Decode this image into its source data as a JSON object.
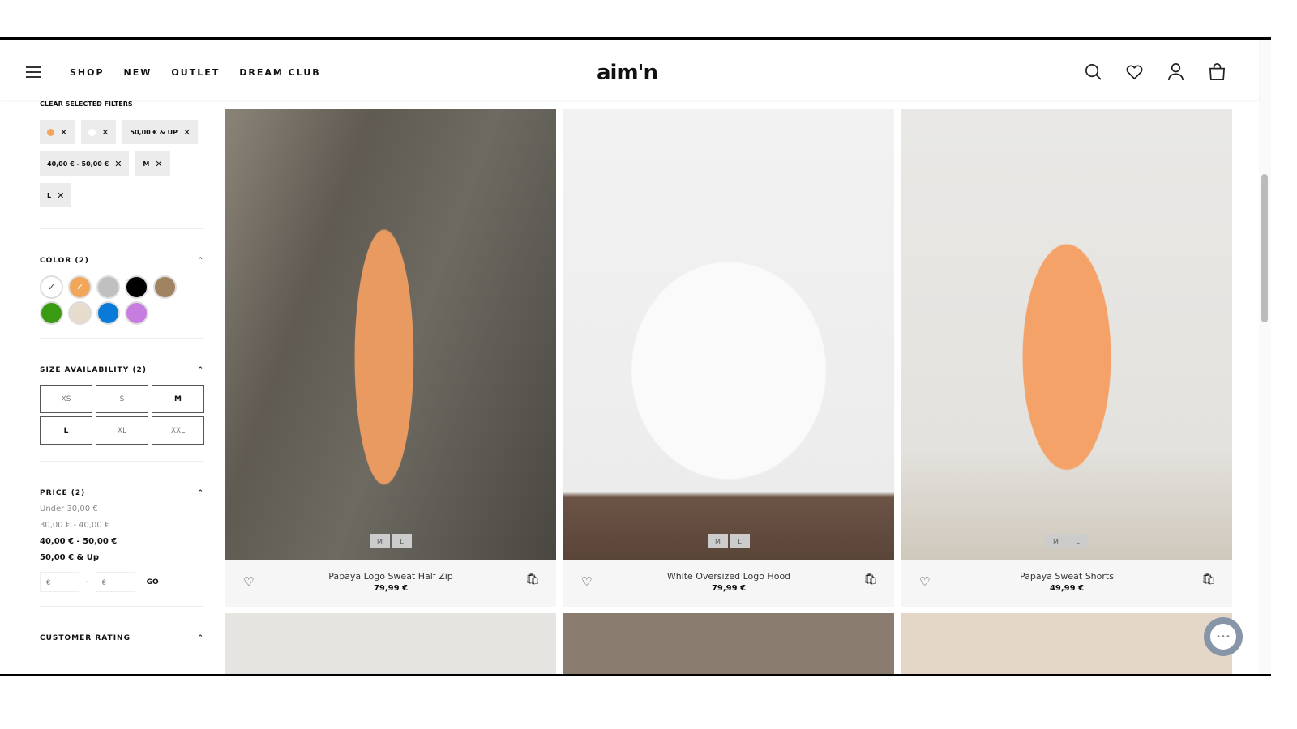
{
  "header": {
    "nav": [
      "SHOP",
      "NEW",
      "OUTLET",
      "DREAM CLUB"
    ],
    "logo": "aim'n"
  },
  "filters": {
    "clear_label": "CLEAR SELECTED FILTERS",
    "chips": [
      {
        "label": "",
        "color": "#f2a65a"
      },
      {
        "label": "",
        "color": "#ffffff"
      },
      {
        "label": "50,00 € & UP"
      },
      {
        "label": "40,00 € - 50,00 €"
      },
      {
        "label": "M"
      },
      {
        "label": "L"
      }
    ],
    "color": {
      "title": "COLOR (2)",
      "swatches": [
        {
          "color": "#ffffff",
          "selected": true
        },
        {
          "color": "#f2a65a",
          "selected": true
        },
        {
          "color": "#c0c0c0"
        },
        {
          "color": "#000000"
        },
        {
          "color": "#a08360"
        },
        {
          "color": "#3a9a12"
        },
        {
          "color": "#e6dccb"
        },
        {
          "color": "#0a7ad8"
        },
        {
          "color": "#c77de0"
        }
      ]
    },
    "size": {
      "title": "SIZE AVAILABILITY (2)",
      "options": [
        {
          "label": "XS"
        },
        {
          "label": "S"
        },
        {
          "label": "M",
          "selected": true
        },
        {
          "label": "L",
          "selected": true
        },
        {
          "label": "XL"
        },
        {
          "label": "XXL"
        }
      ]
    },
    "price": {
      "title": "PRICE (2)",
      "options": [
        {
          "label": "Under 30,00 €"
        },
        {
          "label": "30,00 € - 40,00 €"
        },
        {
          "label": "40,00 € - 50,00 €",
          "selected": true
        },
        {
          "label": "50,00 € & Up",
          "selected": true
        }
      ],
      "min_placeholder": "€",
      "max_placeholder": "€",
      "separator": "-",
      "go_label": "GO"
    },
    "rating": {
      "title": "CUSTOMER RATING"
    }
  },
  "products": [
    {
      "name": "Papaya Logo Sweat Half Zip",
      "price": "79,99 €",
      "sizes": [
        "M",
        "L"
      ]
    },
    {
      "name": "White Oversized Logo Hood",
      "price": "79,99 €",
      "sizes": [
        "M",
        "L"
      ]
    },
    {
      "name": "Papaya Sweat Shorts",
      "price": "49,99 €",
      "sizes": [
        "M",
        "L"
      ]
    }
  ]
}
